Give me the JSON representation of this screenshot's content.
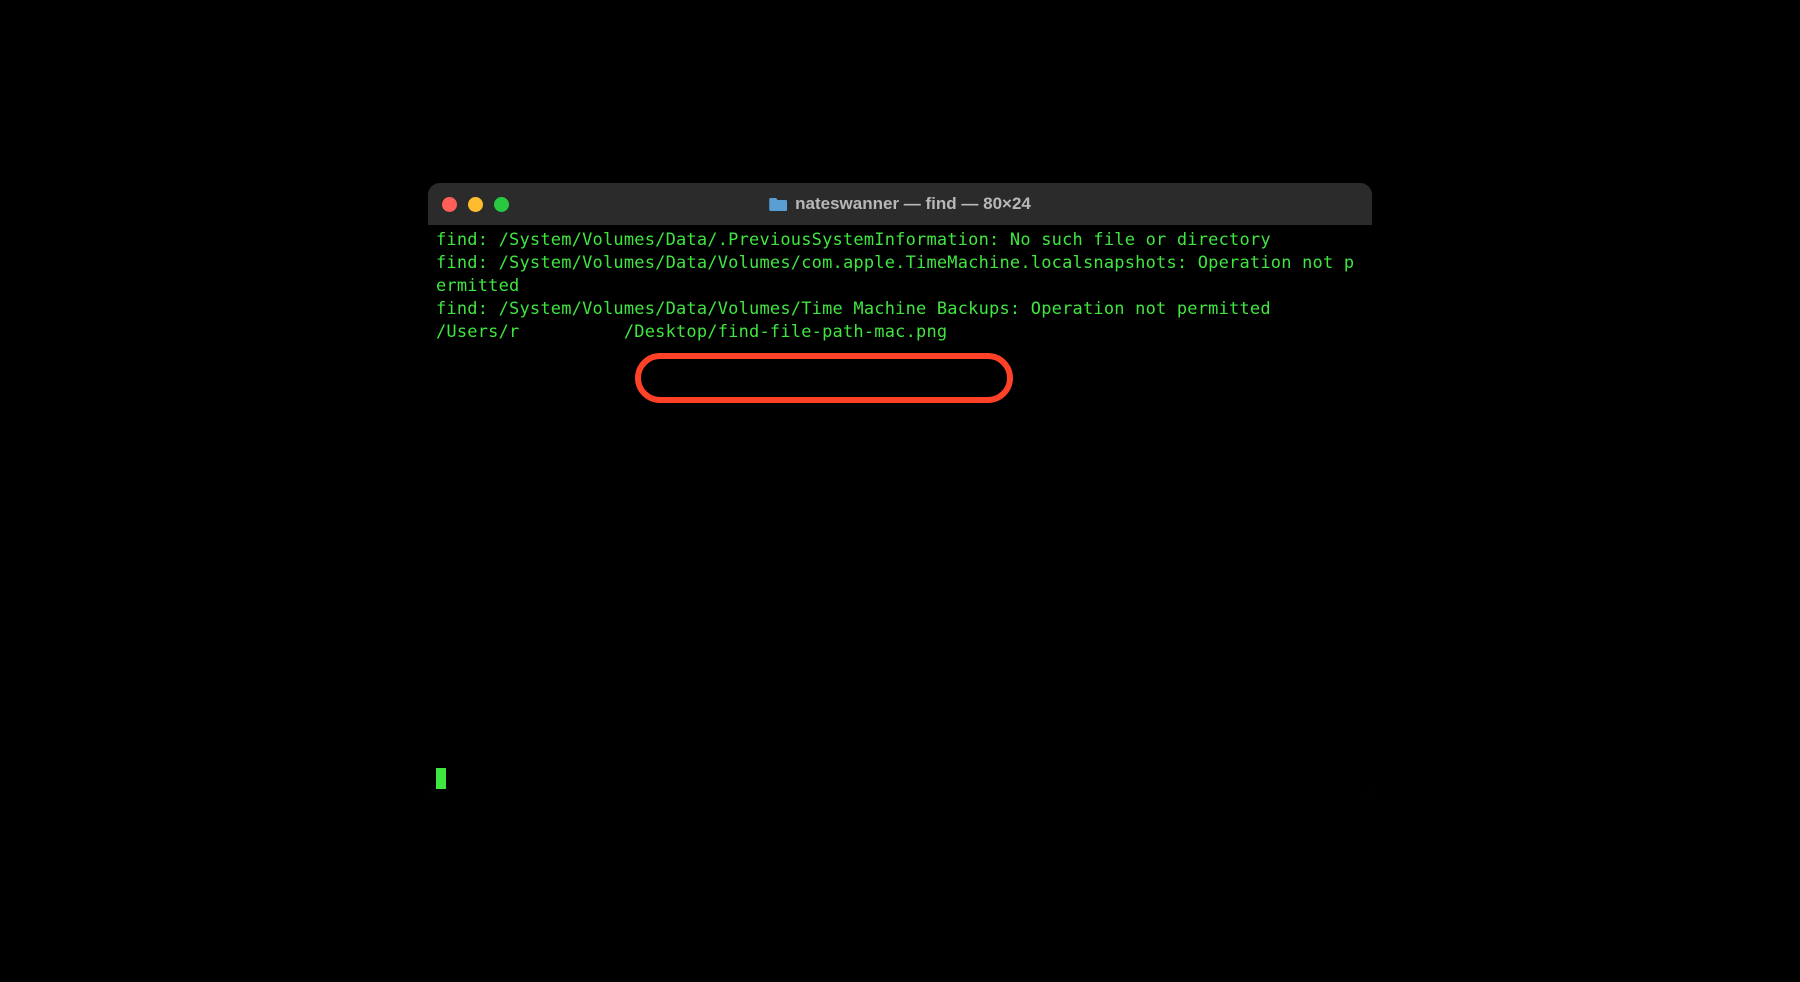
{
  "window": {
    "title": "nateswanner — find — 80×24",
    "traffic_lights": {
      "close": "close-icon",
      "minimize": "minimize-icon",
      "maximize": "maximize-icon"
    },
    "folder_icon": "folder-icon"
  },
  "terminal": {
    "lines": [
      "find: /System/Volumes/Data/.PreviousSystemInformation: No such file or directory",
      "find: /System/Volumes/Data/Volumes/com.apple.TimeMachine.localsnapshots: Operation not permitted",
      "find: /System/Volumes/Data/Volumes/Time Machine Backups: Operation not permitted",
      "/Users/r          /Desktop/find-file-path-mac.png"
    ],
    "highlighted_segment": "Desktop/find-file-path-mac.png"
  },
  "colors": {
    "terminal_bg": "#000000",
    "terminal_text": "#40e640",
    "titlebar_bg": "#2b2b2b",
    "titlebar_text": "#b8b8b8",
    "highlight_border": "#ff4127"
  }
}
